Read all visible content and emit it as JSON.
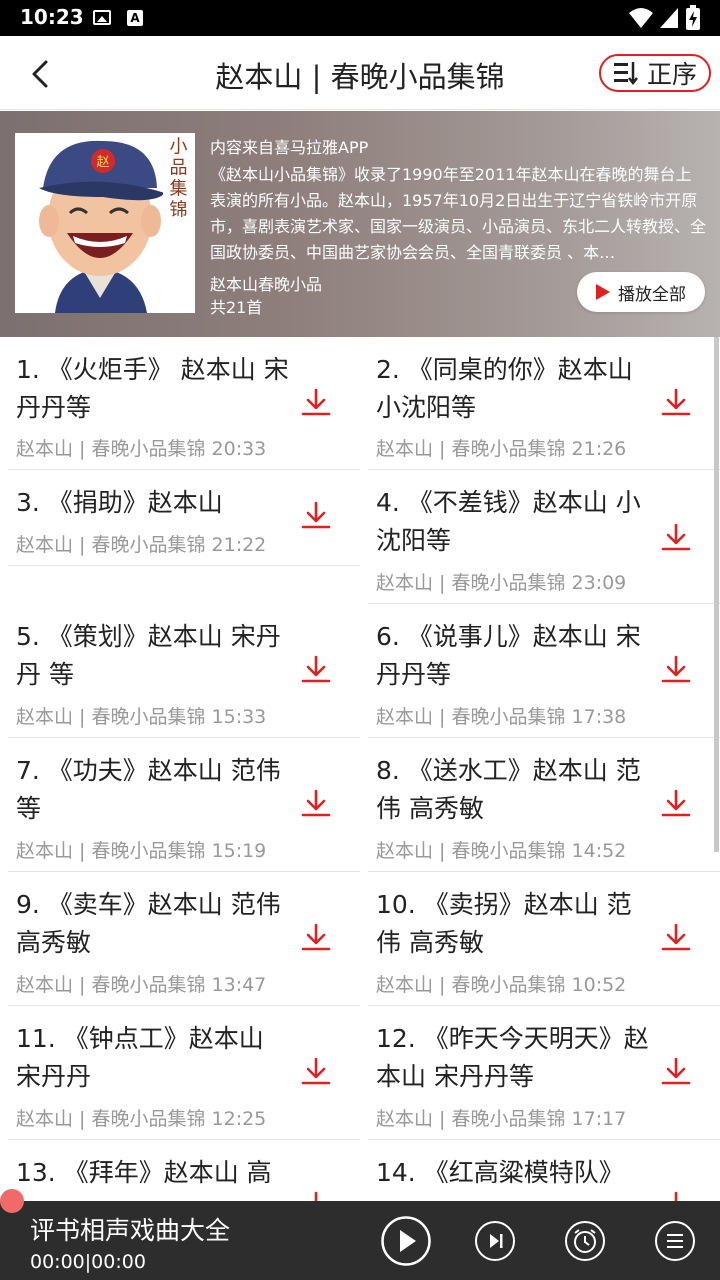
{
  "status": {
    "time": "10:23"
  },
  "header": {
    "title": "赵本山 | 春晚小品集锦",
    "sort_label": "正序"
  },
  "album": {
    "source": "内容来自喜马拉雅APP",
    "description": "《赵本山小品集锦》收录了1990年至2011年赵本山在春晚的舞台上表演的所有小品。赵本山，1957年10月2日出生于辽宁省铁岭市开原市，喜剧表演艺术家、国家一级演员、小品演员、东北二人转教授、全国政协委员、中国曲艺家协会会员、全国青联委员 、本…",
    "author": "赵本山春晚小品",
    "count": "共21首",
    "play_all_label": "播放全部",
    "cover_calligraphy": "赵本山小品集锦",
    "cover_hat_text": "赵"
  },
  "tracks": [
    {
      "title": "1. 《火炬手》 赵本山 宋丹丹等",
      "meta": "赵本山 | 春晚小品集锦   20:33"
    },
    {
      "title": "2. 《同桌的你》赵本山 小沈阳等",
      "meta": "赵本山 | 春晚小品集锦   21:26"
    },
    {
      "title": "3. 《捐助》赵本山",
      "meta": "赵本山 | 春晚小品集锦   21:22"
    },
    {
      "title": "4. 《不差钱》赵本山 小沈阳等",
      "meta": "赵本山 | 春晚小品集锦   23:09"
    },
    {
      "title": "5. 《策划》赵本山 宋丹丹 等",
      "meta": "赵本山 | 春晚小品集锦   15:33"
    },
    {
      "title": "6. 《说事儿》赵本山 宋丹丹等",
      "meta": "赵本山 | 春晚小品集锦   17:38"
    },
    {
      "title": "7. 《功夫》赵本山 范伟等",
      "meta": "赵本山 | 春晚小品集锦   15:19"
    },
    {
      "title": "8. 《送水工》赵本山 范伟 高秀敏",
      "meta": "赵本山 | 春晚小品集锦   14:52"
    },
    {
      "title": "9. 《卖车》赵本山 范伟高秀敏",
      "meta": "赵本山 | 春晚小品集锦   13:47"
    },
    {
      "title": "10. 《卖拐》赵本山 范伟 高秀敏",
      "meta": "赵本山 | 春晚小品集锦   10:52"
    },
    {
      "title": "11. 《钟点工》赵本山 宋丹丹",
      "meta": "赵本山 | 春晚小品集锦   12:25"
    },
    {
      "title": "12. 《昨天今天明天》赵本山 宋丹丹等",
      "meta": "赵本山 | 春晚小品集锦   17:17"
    },
    {
      "title": "13. 《拜年》赵本山 高",
      "meta": ""
    },
    {
      "title": "14. 《红高粱模特队》",
      "meta": ""
    }
  ],
  "player": {
    "title": "评书相声戏曲大全",
    "time": "00:00|00:00"
  },
  "colors": {
    "accent": "#e02020",
    "player_bg": "#2d2d2d"
  },
  "icons": [
    "back-icon",
    "sort-icon",
    "download-icon",
    "play-icon",
    "next-icon",
    "timer-icon",
    "menu-icon"
  ]
}
